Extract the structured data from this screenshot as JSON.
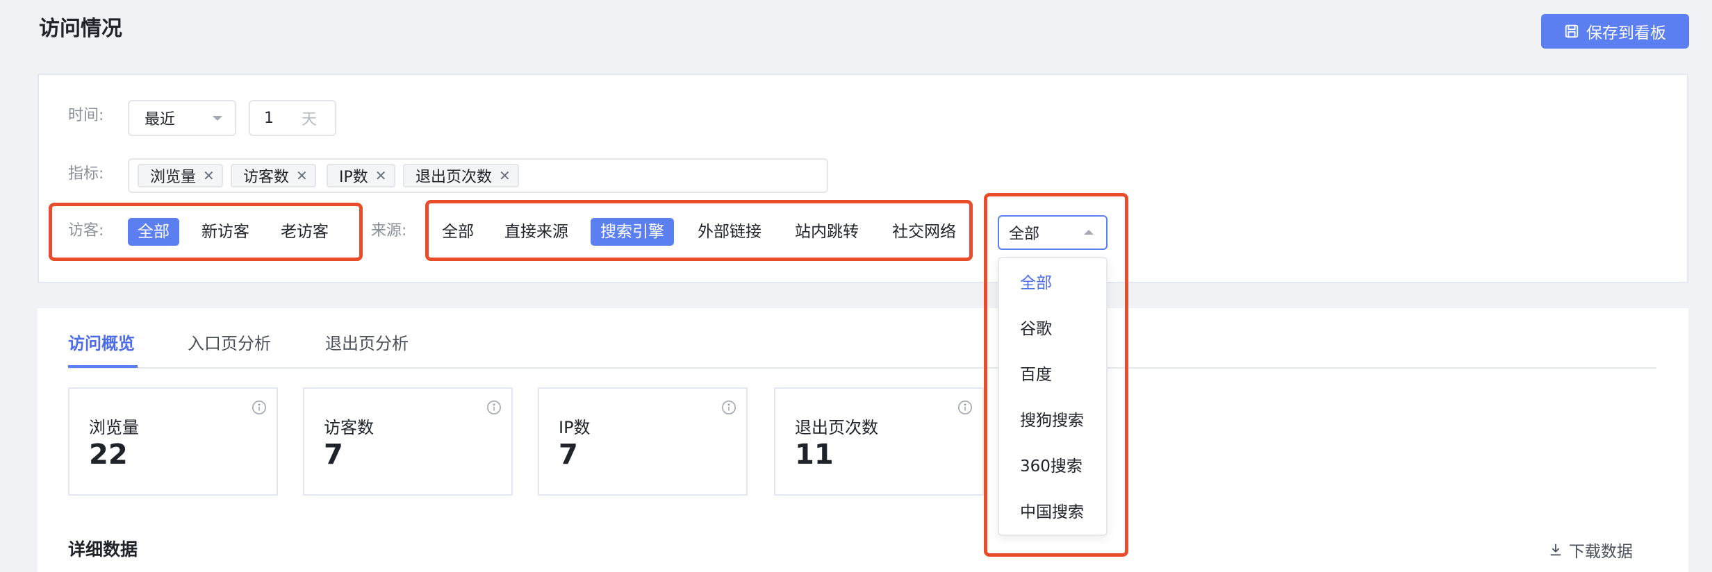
{
  "header": {
    "title": "访问情况",
    "save_label": "保存到看板"
  },
  "filters": {
    "time": {
      "label": "时间:",
      "range_value": "最近",
      "count_value": "1",
      "unit": "天"
    },
    "metrics": {
      "label": "指标:",
      "tags": [
        "浏览量",
        "访客数",
        "IP数",
        "退出页次数"
      ]
    },
    "visitor": {
      "label": "访客:",
      "options": [
        "全部",
        "新访客",
        "老访客"
      ],
      "selected": "全部"
    },
    "source": {
      "label": "来源:",
      "options": [
        "全部",
        "直接来源",
        "搜索引擎",
        "外部链接",
        "站内跳转",
        "社交网络"
      ],
      "selected": "搜索引擎"
    },
    "engine": {
      "value": "全部",
      "options": [
        "全部",
        "谷歌",
        "百度",
        "搜狗搜索",
        "360搜索",
        "中国搜索"
      ],
      "selected": "全部"
    }
  },
  "tabs": [
    "访问概览",
    "入口页分析",
    "退出页分析"
  ],
  "metrics": [
    {
      "label": "浏览量",
      "value": "22"
    },
    {
      "label": "访客数",
      "value": "7"
    },
    {
      "label": "IP数",
      "value": "7"
    },
    {
      "label": "退出页次数",
      "value": "11"
    }
  ],
  "details": {
    "title": "详细数据",
    "download_label": "下载数据"
  },
  "colors": {
    "accent": "#5b7ff0",
    "highlight": "#e84c2b"
  }
}
